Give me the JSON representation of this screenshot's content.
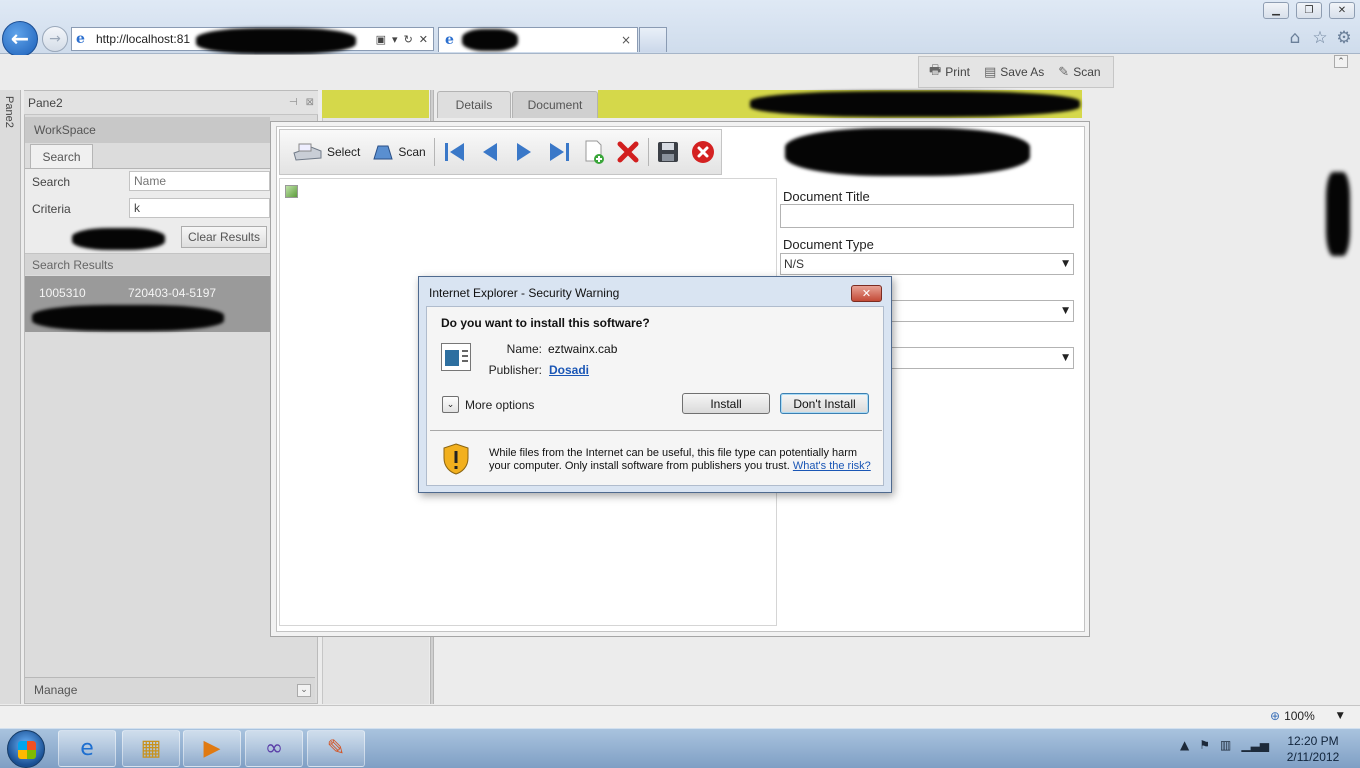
{
  "browser": {
    "address_url": "http://localhost:81",
    "tab_close": "×"
  },
  "page_toolbar": {
    "print": "Print",
    "save_as": "Save As",
    "scan": "Scan"
  },
  "side_strip": {
    "label": "Pane2"
  },
  "pane2": {
    "title": "Pane2",
    "workspace": "WorkSpace",
    "search_tab": "Search",
    "search_label": "Search",
    "search_placeholder": "Name",
    "criteria_label": "Criteria",
    "criteria_value": "k",
    "clear_results": "Clear Results",
    "search_results": "Search Results",
    "result": {
      "id": "1005310",
      "ic_number": "720403-04-5197"
    },
    "manage": "Manage"
  },
  "detail_tabs": {
    "details": "Details",
    "document": "Document"
  },
  "scan_toolbar": {
    "select": "Select",
    "scan": "Scan"
  },
  "doc_fields": {
    "document_title_label": "Document Title",
    "document_type_label": "Document Type",
    "document_type_value": "N/S"
  },
  "dialog": {
    "title": "Internet Explorer - Security Warning",
    "question": "Do you want to install this software?",
    "name_label": "Name:",
    "name_value": "eztwainx.cab",
    "publisher_label": "Publisher:",
    "publisher_value": "Dosadi",
    "more_options": "More options",
    "install": "Install",
    "dont_install": "Don't Install",
    "warning": "While files from the Internet can be useful, this file type can potentially harm your computer. Only install software from publishers you trust.",
    "risk_link": "What's the risk?"
  },
  "status_bar": {
    "zoom": "100%"
  },
  "taskbar": {
    "time": "12:20 PM",
    "date": "2/11/2012"
  },
  "colors": {
    "accent_yellow": "#d5d84a",
    "link_blue": "#1a56b5",
    "close_red": "#c34a36"
  }
}
